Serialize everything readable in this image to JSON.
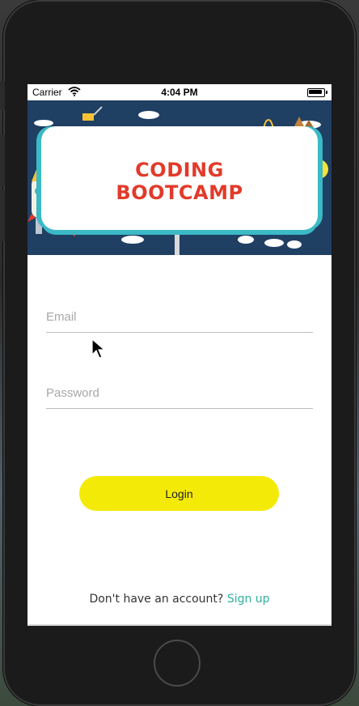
{
  "status_bar": {
    "carrier": "Carrier",
    "time": "4:04 PM",
    "wifi_icon": "wifi-icon",
    "battery_icon": "battery-icon"
  },
  "banner": {
    "title_line1": "CODING",
    "title_line2": "BOOTCAMP"
  },
  "form": {
    "email_placeholder": "Email",
    "email_value": "",
    "password_placeholder": "Password",
    "password_value": ""
  },
  "login_button": {
    "label": "Login"
  },
  "signup": {
    "prompt": "Don't have an account?",
    "link": "Sign up"
  },
  "colors": {
    "button_bg": "#f4ea08",
    "link": "#2fb09c",
    "title": "#e23a2a",
    "banner_bg": "#1f3f63"
  }
}
